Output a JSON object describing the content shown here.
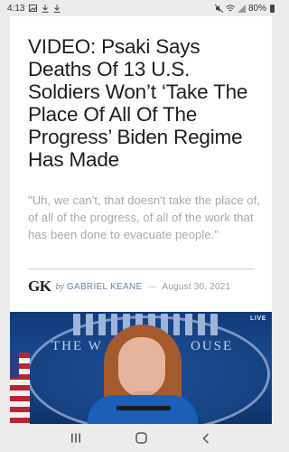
{
  "status_bar": {
    "time": "4:13",
    "battery_percent": "80%",
    "icons_left": [
      "image-icon",
      "download-icon",
      "download-icon"
    ],
    "icons_right": [
      "mute-icon",
      "wifi-icon",
      "signal-icon",
      "battery-icon"
    ]
  },
  "article": {
    "headline": "VIDEO: Psaki Says Deaths Of 13 U.S. Soldiers Won’t ‘Take The Place Of All Of The Progress’ Biden Regime Has Made",
    "quote": "\"Uh, we can't, that doesn't take the place of, of all of the progress, of all of the work that has been done to evacuate people.\"",
    "byline": {
      "logo": "GK",
      "by": "by",
      "author": "GABRIEL KEANE",
      "separator": "—",
      "date": "August 30, 2021"
    },
    "video": {
      "live_label": "LIVE",
      "backdrop_text_left": "THE W",
      "backdrop_text_right": "OUSE"
    }
  },
  "nav_bar": {
    "buttons": [
      "recents-icon",
      "home-icon",
      "back-icon"
    ]
  }
}
